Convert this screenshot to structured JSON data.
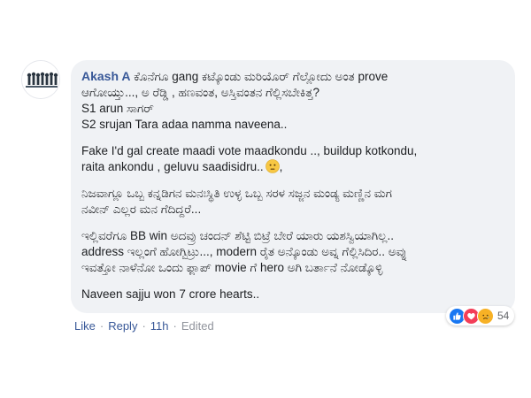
{
  "comment": {
    "author": "Akash A",
    "paragraphs": [
      {
        "lines": [
          "ಕೊನೆಗೂ gang ಕಟ್ಕೊಂಡು ಮರಿಯೊರ್ ಗೆಲ್ಲೋದು ಅಂತ prove",
          "ಆಗೋಯ್ತು..., ಅ ರೆಡ್ಡಿ , ಹಣವಂತ, ಅಸ್ತಿವಂತನ ಗೆಲ್ಲಿಸಬೇಕಿತ್ತ?",
          "S1 arun ಸಾಗರ್",
          "S2 srujan Tara adaa namma naveena.."
        ]
      },
      {
        "lines": [
          "Fake I'd gal create maadi vote maadkondu .., buildup kotkondu,",
          "raita ankondu , geluvu saadisidru.."
        ],
        "trailing": ","
      },
      {
        "lines": [
          "ನಿಜವಾಗ್ಲೂ ಒಬ್ಬ ಕನ್ನಡಿಗನ ಮನಃಸ್ಥಿತಿ ಉಳ್ಳ ಒಬ್ಬ ಸರಳ ಸಜ್ಜನ ಮಂಡ್ಯ ಮಣ್ಣಿನ ಮಗ",
          "ನವೀನ್ ಎಲ್ಲರ ಮನ ಗೆದಿದ್ದರೆ..."
        ]
      },
      {
        "lines": [
          "ಇಲ್ಲಿವರೆಗೂ BB win ಅದವ್ರು ಚಂದನ್ ಶೆಟ್ಟಿ ಬಿಟ್ರೆ ಬೇರೆ ಯಾರು ಯಶಸ್ವಿಯಾಗಿಲ್ಲ..",
          "address ಇಲ್ಲಂಗೆ ಹೋಗ್ಬಿಟ್ರು..., modern ರೈತ ಅನ್ಕೊಂಡು ಅವ್ನ ಗೆಲ್ಲಿಸಿದಿರ.. ಅವ್ನು",
          "ಇವತ್ತೋ ನಾಳೆನೋ ಒಂದು ಫ್ಲಾಪ್ movie ಗೆ hero ಅಗಿ ಬರ್ತಾನೆ ನೋಡ್ಕೊಳ್ಳಿ"
        ]
      },
      {
        "lines": [
          "Naveen sajju won 7 crore hearts.."
        ]
      }
    ],
    "emoji": "confused-face-icon"
  },
  "reactions": {
    "icons": [
      "like-icon",
      "love-icon",
      "sad-icon"
    ],
    "count": "54",
    "colors": {
      "like": "#1877f2",
      "love": "#f33e58",
      "sad": "#f7b125"
    }
  },
  "actions": {
    "like": "Like",
    "reply": "Reply",
    "time": "11h",
    "edited": "Edited",
    "separator": "·"
  },
  "colors": {
    "author": "#385898",
    "bubble": "#f0f2f5",
    "link": "#385898",
    "muted": "#90949c"
  }
}
